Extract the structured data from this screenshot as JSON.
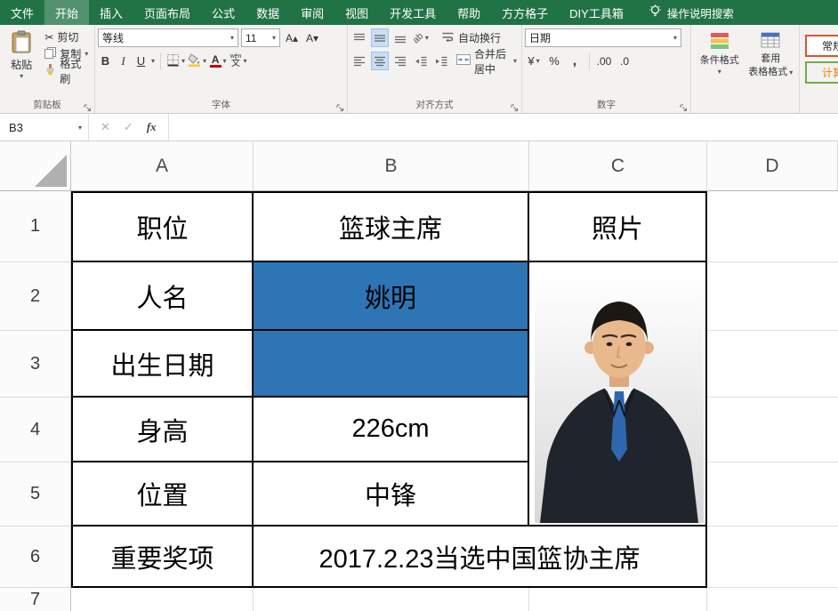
{
  "menubar": {
    "tabs": [
      {
        "label": "文件"
      },
      {
        "label": "开始"
      },
      {
        "label": "插入"
      },
      {
        "label": "页面布局"
      },
      {
        "label": "公式"
      },
      {
        "label": "数据"
      },
      {
        "label": "审阅"
      },
      {
        "label": "视图"
      },
      {
        "label": "开发工具"
      },
      {
        "label": "帮助"
      },
      {
        "label": "方方格子"
      },
      {
        "label": "DIY工具箱"
      }
    ],
    "tell_me": "操作说明搜索"
  },
  "ribbon": {
    "clipboard": {
      "label": "剪贴板",
      "paste": "粘贴",
      "cut": "剪切",
      "copy": "复制",
      "format_painter": "格式刷"
    },
    "font": {
      "label": "字体",
      "name": "等线",
      "size": "11",
      "bold": "B",
      "italic": "I",
      "underline": "U",
      "phonetic_top": "wén",
      "phonetic_bottom": "文"
    },
    "alignment": {
      "label": "对齐方式",
      "wrap_text": "自动换行",
      "merge_center": "合并后居中"
    },
    "number": {
      "label": "数字",
      "format": "日期"
    },
    "styles": {
      "conditional": "条件格式",
      "table_format_line1": "套用",
      "table_format_line2": "表格格式",
      "cell_style_normal": "常规",
      "cell_style_calc": "计算"
    }
  },
  "formula_bar": {
    "name_box": "B3",
    "value": ""
  },
  "sheet": {
    "col_headers": [
      "A",
      "B",
      "C",
      "D"
    ],
    "row_headers": [
      "1",
      "2",
      "3",
      "4",
      "5",
      "6",
      "7"
    ],
    "cells": {
      "a1": "职位",
      "b1": "篮球主席",
      "c1": "照片",
      "a2": "人名",
      "b2": "姚明",
      "a3": "出生日期",
      "b3": "",
      "a4": "身高",
      "b4": "226cm",
      "a5": "位置",
      "b5": "中锋",
      "a6": "重要奖项",
      "b6": "2017.2.23当选中国篮协主席"
    }
  },
  "icons": {
    "chevron_down": "▾",
    "scissors": "✂",
    "increase_font": "A▴",
    "decrease_font": "A▾",
    "cancel": "✕",
    "check": "✓",
    "fx": "fx",
    "orientation": "ab",
    "font_color_a": "A",
    "currency": "¥",
    "percent": "%",
    "comma": ",",
    "increase_decimal": ".00",
    "decrease_decimal": ".0"
  },
  "colors": {
    "excel_green": "#217346",
    "selection_fill": "#2e75b6",
    "table_border": "#000000",
    "style_normal_border": "#d65532",
    "style_calc_border": "#70ad47",
    "style_calc_text": "#fa7d00"
  }
}
